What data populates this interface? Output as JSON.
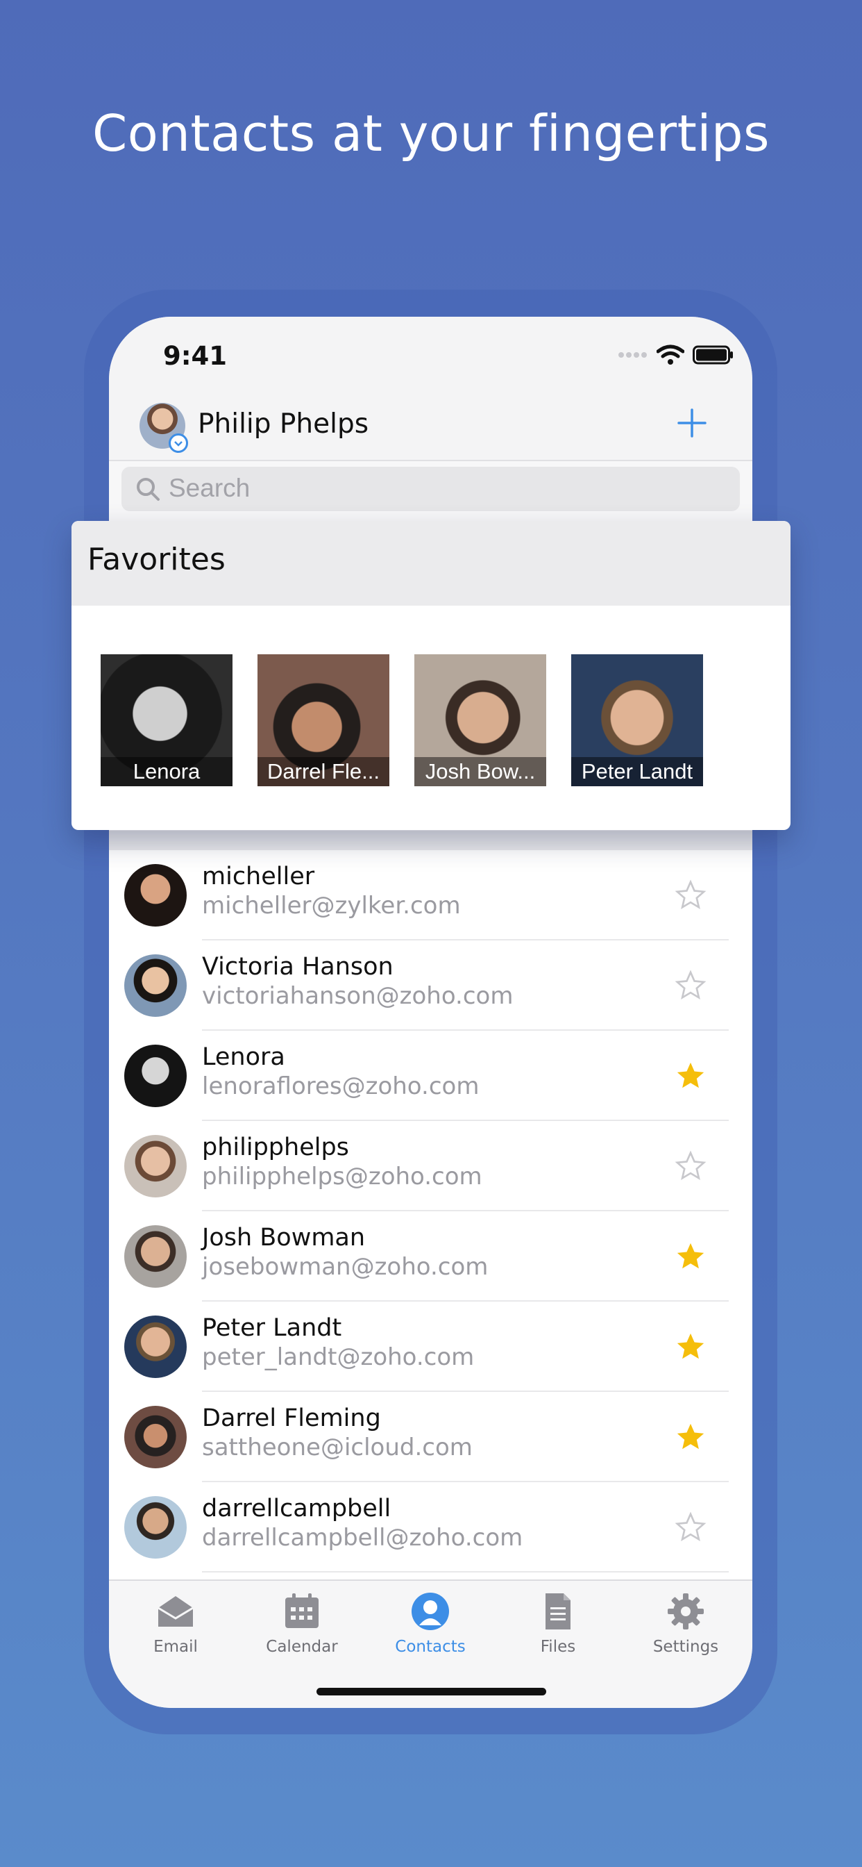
{
  "headline": "Contacts at your fingertips",
  "status": {
    "time": "9:41"
  },
  "header": {
    "account_name": "Philip Phelps"
  },
  "search": {
    "placeholder": "Search"
  },
  "favorites": {
    "title": "Favorites",
    "items": [
      {
        "label": "Lenora"
      },
      {
        "label": "Darrel Fle..."
      },
      {
        "label": "Josh Bow..."
      },
      {
        "label": "Peter Landt"
      }
    ]
  },
  "contacts": [
    {
      "name": "micheller",
      "email": "micheller@zylker.com",
      "favorite": false
    },
    {
      "name": "Victoria Hanson",
      "email": "victoriahanson@zoho.com",
      "favorite": false
    },
    {
      "name": "Lenora",
      "email": "lenoraflores@zoho.com",
      "favorite": true
    },
    {
      "name": "philipphelps",
      "email": "philipphelps@zoho.com",
      "favorite": false
    },
    {
      "name": "Josh Bowman",
      "email": "josebowman@zoho.com",
      "favorite": true
    },
    {
      "name": "Peter Landt",
      "email": "peter_landt@zoho.com",
      "favorite": true
    },
    {
      "name": "Darrel Fleming",
      "email": "sattheone@icloud.com",
      "favorite": true
    },
    {
      "name": "darrellcampbell",
      "email": "darrellcampbell@zoho.com",
      "favorite": false
    }
  ],
  "tabs": [
    {
      "label": "Email",
      "icon": "envelope-icon",
      "active": false
    },
    {
      "label": "Calendar",
      "icon": "calendar-icon",
      "active": false
    },
    {
      "label": "Contacts",
      "icon": "person-icon",
      "active": true
    },
    {
      "label": "Files",
      "icon": "document-icon",
      "active": false
    },
    {
      "label": "Settings",
      "icon": "gear-icon",
      "active": false
    }
  ],
  "colors": {
    "accent": "#3d8ee6",
    "star_filled": "#f5be0b",
    "star_empty": "#c8c8cc",
    "background_top": "#4f6bb9",
    "background_bottom": "#5a8bcb"
  }
}
